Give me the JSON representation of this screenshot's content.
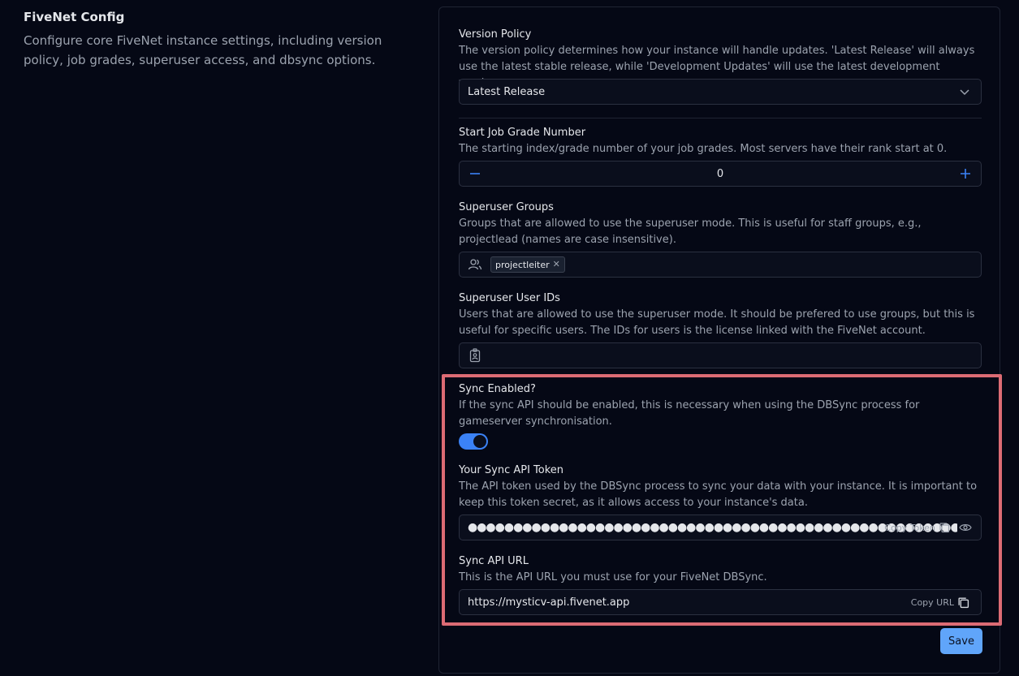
{
  "section": {
    "title": "FiveNet Config",
    "description": "Configure core FiveNet instance settings, including version policy, job grades, superuser access, and dbsync options."
  },
  "version_policy": {
    "label": "Version Policy",
    "help": "The version policy determines how your instance will handle updates. 'Latest Release' will always use the latest stable release, while 'Development Updates' will use the latest development version.",
    "selected": "Latest Release"
  },
  "start_job_grade": {
    "label": "Start Job Grade Number",
    "help": "The starting index/grade number of your job grades. Most servers have their rank start at 0.",
    "value": "0"
  },
  "superuser_groups": {
    "label": "Superuser Groups",
    "help": "Groups that are allowed to use the superuser mode. This is useful for staff groups, e.g., projectlead (names are case insensitive).",
    "tags": [
      "projectleiter"
    ]
  },
  "superuser_user_ids": {
    "label": "Superuser User IDs",
    "help": "Users that are allowed to use the superuser mode. It should be prefered to use groups, but this is useful for specific users. The IDs for users is the license linked with the FiveNet account."
  },
  "sync_enabled": {
    "label": "Sync Enabled?",
    "help": "If the sync API should be enabled, this is necessary when using the DBSync process for gameserver synchronisation.",
    "on": true
  },
  "sync_token": {
    "label": "Your Sync API Token",
    "help": "The API token used by the DBSync process to sync your data with your instance. It is important to keep this token secret, as it allows access to your instance's data.",
    "masked": "●●●●●●●●●●●●●●●●●●●●●●●●●●●●●●●●●●●●●●●●●●●●●●●●●●●●●●●●●●●●●●●",
    "copy_label": "Copy Token"
  },
  "sync_url": {
    "label": "Sync API URL",
    "help": "This is the API URL you must use for your FiveNet DBSync.",
    "value": "https://mysticv-api.fivenet.app",
    "copy_label": "Copy URL"
  },
  "save_label": "Save",
  "colors": {
    "accent": "#3b82f6",
    "save_bg": "#60a5fa",
    "highlight": "#dc6b74",
    "background": "#050815"
  }
}
